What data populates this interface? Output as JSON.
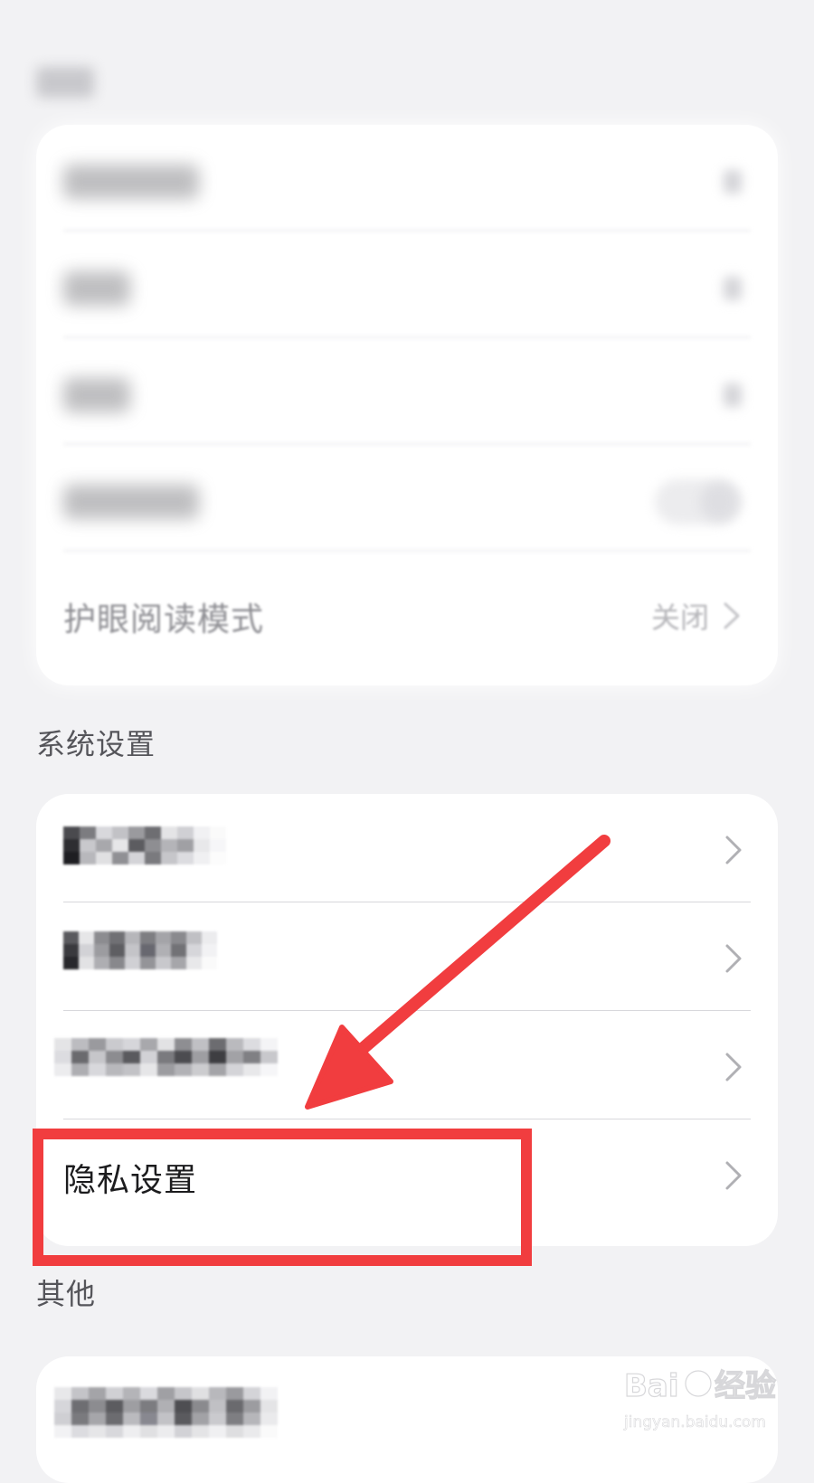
{
  "blurred_section": {
    "rows": [
      {
        "label": "护眼阅读模式",
        "value": "关闭"
      }
    ]
  },
  "system_settings": {
    "section_label": "系统设置",
    "rows": [
      {
        "label": "阅读偏好",
        "obscured": true
      },
      {
        "label": "消息通知",
        "obscured": true
      },
      {
        "label": "自动续费管理",
        "obscured": true
      },
      {
        "label": "隐私设置",
        "obscured": false
      }
    ]
  },
  "other": {
    "section_label": "其他"
  },
  "annotation": {
    "highlight_color": "#f13d3f",
    "arrow_color": "#f13d3f",
    "highlighted_item": "隐私设置"
  },
  "icons": {
    "chevron": "chevron-right-icon"
  },
  "watermark": {
    "brand": "Bai du 经验",
    "url": "jingyan.baidu.com"
  }
}
